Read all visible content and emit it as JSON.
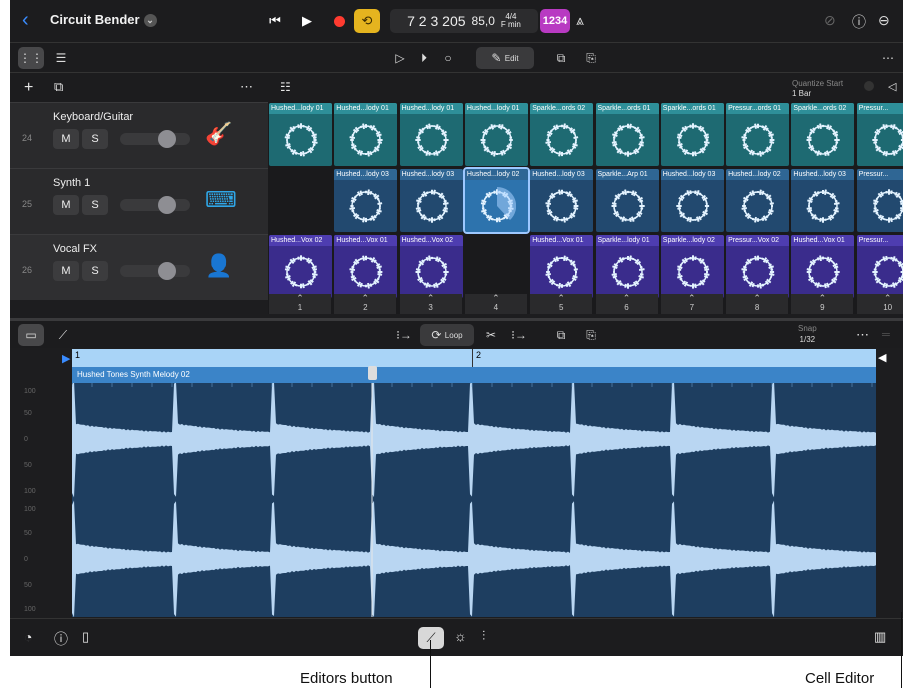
{
  "topbar": {
    "back_icon": "chevron-left-icon",
    "project_name": "Circuit Bender",
    "lcd": {
      "position": "7 2 3 205",
      "tempo": "85,0",
      "signature": "4/4",
      "key": "F min"
    },
    "count_in": "1234"
  },
  "toolbar2": {
    "edit_label": "Edit"
  },
  "tracks": [
    {
      "number": "24",
      "name": "Keyboard/Guitar",
      "mute": "M",
      "solo": "S",
      "icon": "guitar-icon"
    },
    {
      "number": "25",
      "name": "Synth 1",
      "mute": "M",
      "solo": "S",
      "icon": "keyboard-icon"
    },
    {
      "number": "26",
      "name": "Vocal FX",
      "mute": "M",
      "solo": "S",
      "icon": "vocalist-icon"
    }
  ],
  "quantize": {
    "label": "Quantize Start",
    "value": "1 Bar"
  },
  "grid": {
    "row1": [
      "Hushed...lody 01",
      "Hushed...lody 01",
      "Hushed...lody 01",
      "Hushed...lody 01",
      "Sparkle...ords 02",
      "Sparkle...ords 01",
      "Sparkle...ords 01",
      "Pressur...ords 01",
      "Sparkle...ords 02",
      "Pressur..."
    ],
    "row2": [
      "",
      "Hushed...lody 03",
      "Hushed...lody 03",
      "Hushed...lody 02",
      "Hushed...lody 03",
      "Sparkle...Arp 01",
      "Hushed...lody 03",
      "Hushed...lody 02",
      "Hushed...lody 03",
      "Pressur..."
    ],
    "row3": [
      "Hushed...Vox 02",
      "Hushed...Vox 01",
      "Hushed...Vox 02",
      "",
      "Hushed...Vox 01",
      "Sparkle...lody 01",
      "Sparkle...lody 02",
      "Pressur...Vox 02",
      "Hushed...Vox 01",
      "Pressur..."
    ],
    "columns": [
      "1",
      "2",
      "3",
      "4",
      "5",
      "6",
      "7",
      "8",
      "9",
      "10"
    ]
  },
  "editor": {
    "loop_label": "Loop",
    "snap_label": "Snap",
    "snap_value": "1/32",
    "ruler_marks": [
      "1",
      "2"
    ],
    "region_name": "Hushed Tones Synth Melody 02",
    "db_scale": [
      "100",
      "50",
      "0",
      "50",
      "100",
      "100",
      "50",
      "0",
      "50",
      "100"
    ]
  },
  "callouts": {
    "editors_button": "Editors button",
    "cell_editor": "Cell Editor"
  },
  "colors": {
    "accent": "#3a8cff",
    "record": "#ff3b30",
    "cycle": "#e5b41f",
    "count_in": "#b83ac2",
    "waveform": "#b9d6f2"
  }
}
